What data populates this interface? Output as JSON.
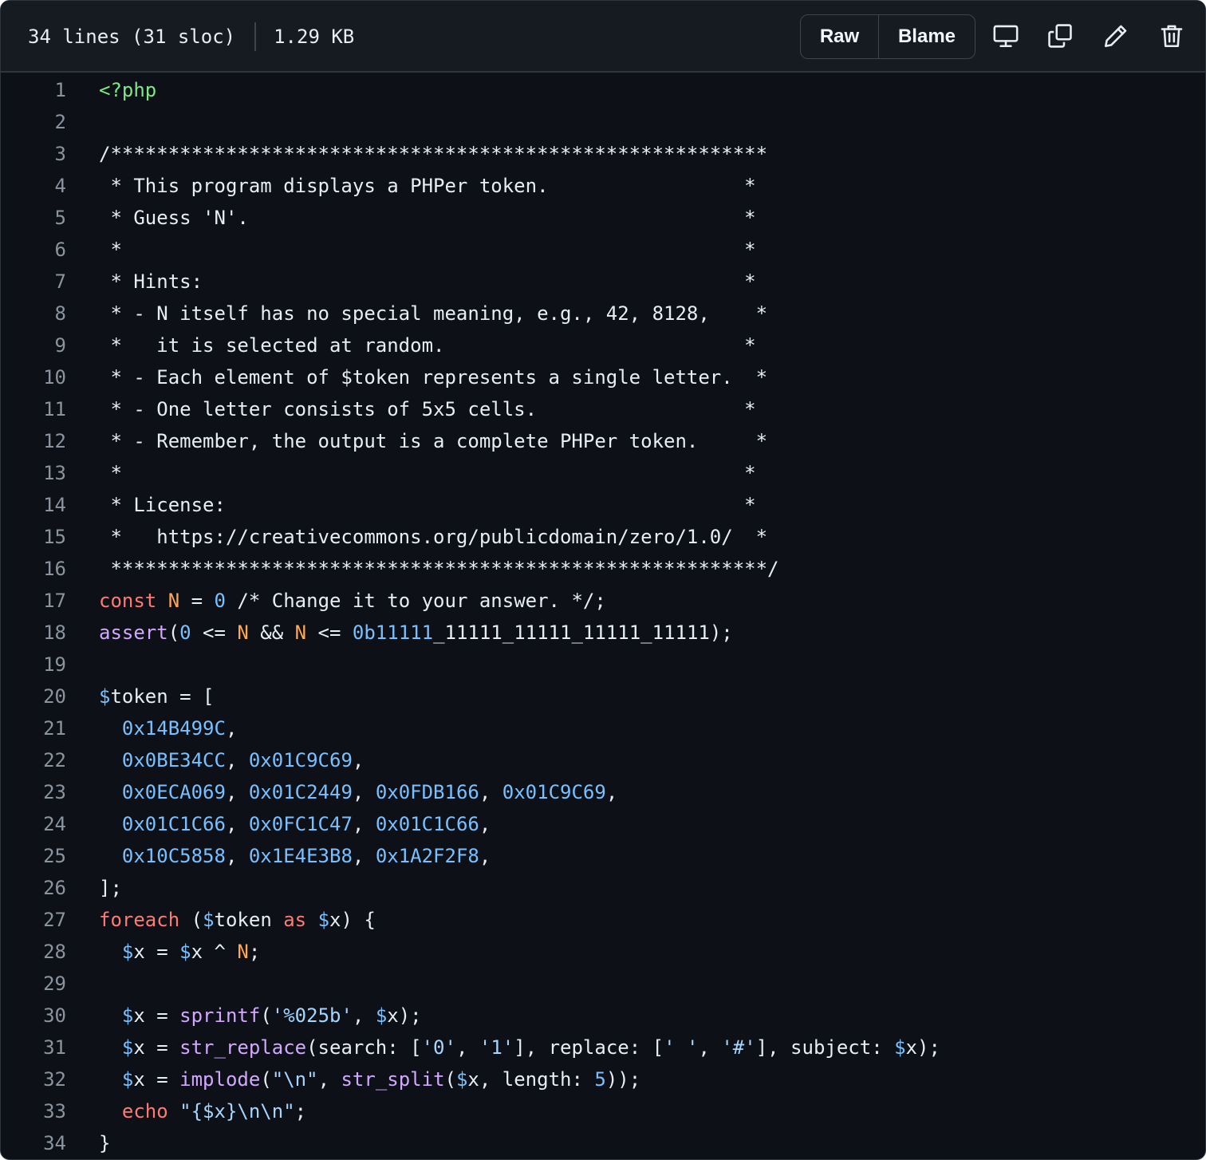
{
  "file_info": {
    "lines_label": "34 lines (31 sloc)",
    "size_label": "1.29 KB"
  },
  "toolbar": {
    "raw_label": "Raw",
    "blame_label": "Blame",
    "icons": [
      "desktop-icon",
      "copy-icon",
      "pencil-icon",
      "trash-icon"
    ]
  },
  "theme": {
    "background": "#0d1117",
    "header_background": "#161b22",
    "border": "#30363d",
    "line_number": "#8b949e",
    "text": "#e6edf3",
    "keyword": "#ff7b72",
    "constant": "#ffa657",
    "number": "#79c0ff",
    "function": "#d2a8ff",
    "string": "#a5d6ff",
    "tag": "#7ee787"
  },
  "code": {
    "lines": [
      {
        "n": "1",
        "tokens": [
          [
            "<?php",
            "tag"
          ]
        ]
      },
      {
        "n": "2",
        "tokens": []
      },
      {
        "n": "3",
        "tokens": [
          [
            "/*********************************************************",
            "comment"
          ]
        ]
      },
      {
        "n": "4",
        "tokens": [
          [
            " * This program displays a PHPer token.                 *",
            "comment"
          ]
        ]
      },
      {
        "n": "5",
        "tokens": [
          [
            " * Guess 'N'.                                           *",
            "comment"
          ]
        ]
      },
      {
        "n": "6",
        "tokens": [
          [
            " *                                                      *",
            "comment"
          ]
        ]
      },
      {
        "n": "7",
        "tokens": [
          [
            " * Hints:                                               *",
            "comment"
          ]
        ]
      },
      {
        "n": "8",
        "tokens": [
          [
            " * - N itself has no special meaning, e.g., 42, 8128,    *",
            "comment"
          ]
        ]
      },
      {
        "n": "9",
        "tokens": [
          [
            " *   it is selected at random.                          *",
            "comment"
          ]
        ]
      },
      {
        "n": "10",
        "tokens": [
          [
            " * - Each element of $token represents a single letter.  *",
            "comment"
          ]
        ]
      },
      {
        "n": "11",
        "tokens": [
          [
            " * - One letter consists of 5x5 cells.                  *",
            "comment"
          ]
        ]
      },
      {
        "n": "12",
        "tokens": [
          [
            " * - Remember, the output is a complete PHPer token.     *",
            "comment"
          ]
        ]
      },
      {
        "n": "13",
        "tokens": [
          [
            " *                                                      *",
            "comment"
          ]
        ]
      },
      {
        "n": "14",
        "tokens": [
          [
            " * License:                                             *",
            "comment"
          ]
        ]
      },
      {
        "n": "15",
        "tokens": [
          [
            " *   https://creativecommons.org/publicdomain/zero/1.0/  *",
            "comment"
          ]
        ]
      },
      {
        "n": "16",
        "tokens": [
          [
            " *********************************************************/",
            "comment"
          ]
        ]
      },
      {
        "n": "17",
        "tokens": [
          [
            "const",
            "keyword"
          ],
          [
            " ",
            "plain"
          ],
          [
            "N",
            "constant"
          ],
          [
            " = ",
            "plain"
          ],
          [
            "0",
            "number"
          ],
          [
            " /* Change it to your answer. */;",
            "comment"
          ]
        ]
      },
      {
        "n": "18",
        "tokens": [
          [
            "assert",
            "function"
          ],
          [
            "(",
            "plain"
          ],
          [
            "0",
            "number"
          ],
          [
            " <= ",
            "plain"
          ],
          [
            "N",
            "constant"
          ],
          [
            " && ",
            "plain"
          ],
          [
            "N",
            "constant"
          ],
          [
            " <= ",
            "plain"
          ],
          [
            "0b11111",
            "number"
          ],
          [
            "_11111_11111_11111_11111);",
            "plain"
          ]
        ]
      },
      {
        "n": "19",
        "tokens": []
      },
      {
        "n": "20",
        "tokens": [
          [
            "$",
            "variable"
          ],
          [
            "token = [",
            "plain"
          ]
        ]
      },
      {
        "n": "21",
        "tokens": [
          [
            "  ",
            "plain"
          ],
          [
            "0x14B499C",
            "number"
          ],
          [
            ",",
            "plain"
          ]
        ]
      },
      {
        "n": "22",
        "tokens": [
          [
            "  ",
            "plain"
          ],
          [
            "0x0BE34CC",
            "number"
          ],
          [
            ", ",
            "plain"
          ],
          [
            "0x01C9C69",
            "number"
          ],
          [
            ",",
            "plain"
          ]
        ]
      },
      {
        "n": "23",
        "tokens": [
          [
            "  ",
            "plain"
          ],
          [
            "0x0ECA069",
            "number"
          ],
          [
            ", ",
            "plain"
          ],
          [
            "0x01C2449",
            "number"
          ],
          [
            ", ",
            "plain"
          ],
          [
            "0x0FDB166",
            "number"
          ],
          [
            ", ",
            "plain"
          ],
          [
            "0x01C9C69",
            "number"
          ],
          [
            ",",
            "plain"
          ]
        ]
      },
      {
        "n": "24",
        "tokens": [
          [
            "  ",
            "plain"
          ],
          [
            "0x01C1C66",
            "number"
          ],
          [
            ", ",
            "plain"
          ],
          [
            "0x0FC1C47",
            "number"
          ],
          [
            ", ",
            "plain"
          ],
          [
            "0x01C1C66",
            "number"
          ],
          [
            ",",
            "plain"
          ]
        ]
      },
      {
        "n": "25",
        "tokens": [
          [
            "  ",
            "plain"
          ],
          [
            "0x10C5858",
            "number"
          ],
          [
            ", ",
            "plain"
          ],
          [
            "0x1E4E3B8",
            "number"
          ],
          [
            ", ",
            "plain"
          ],
          [
            "0x1A2F2F8",
            "number"
          ],
          [
            ",",
            "plain"
          ]
        ]
      },
      {
        "n": "26",
        "tokens": [
          [
            "];",
            "plain"
          ]
        ]
      },
      {
        "n": "27",
        "tokens": [
          [
            "foreach",
            "keyword"
          ],
          [
            " (",
            "plain"
          ],
          [
            "$",
            "variable"
          ],
          [
            "token ",
            "plain"
          ],
          [
            "as",
            "keyword"
          ],
          [
            " ",
            "plain"
          ],
          [
            "$",
            "variable"
          ],
          [
            "x) {",
            "plain"
          ]
        ]
      },
      {
        "n": "28",
        "tokens": [
          [
            "  ",
            "plain"
          ],
          [
            "$",
            "variable"
          ],
          [
            "x = ",
            "plain"
          ],
          [
            "$",
            "variable"
          ],
          [
            "x ^ ",
            "plain"
          ],
          [
            "N",
            "constant"
          ],
          [
            ";",
            "plain"
          ]
        ]
      },
      {
        "n": "29",
        "tokens": []
      },
      {
        "n": "30",
        "tokens": [
          [
            "  ",
            "plain"
          ],
          [
            "$",
            "variable"
          ],
          [
            "x = ",
            "plain"
          ],
          [
            "sprintf",
            "function"
          ],
          [
            "(",
            "plain"
          ],
          [
            "'%025b'",
            "string"
          ],
          [
            ", ",
            "plain"
          ],
          [
            "$",
            "variable"
          ],
          [
            "x);",
            "plain"
          ]
        ]
      },
      {
        "n": "31",
        "tokens": [
          [
            "  ",
            "plain"
          ],
          [
            "$",
            "variable"
          ],
          [
            "x = ",
            "plain"
          ],
          [
            "str_replace",
            "function"
          ],
          [
            "(search: [",
            "plain"
          ],
          [
            "'0'",
            "string"
          ],
          [
            ", ",
            "plain"
          ],
          [
            "'1'",
            "string"
          ],
          [
            "], replace: [",
            "plain"
          ],
          [
            "' '",
            "string"
          ],
          [
            ", ",
            "plain"
          ],
          [
            "'#'",
            "string"
          ],
          [
            "], subject: ",
            "plain"
          ],
          [
            "$",
            "variable"
          ],
          [
            "x);",
            "plain"
          ]
        ]
      },
      {
        "n": "32",
        "tokens": [
          [
            "  ",
            "plain"
          ],
          [
            "$",
            "variable"
          ],
          [
            "x = ",
            "plain"
          ],
          [
            "implode",
            "function"
          ],
          [
            "(",
            "plain"
          ],
          [
            "\"\\n\"",
            "string"
          ],
          [
            ", ",
            "plain"
          ],
          [
            "str_split",
            "function"
          ],
          [
            "(",
            "plain"
          ],
          [
            "$",
            "variable"
          ],
          [
            "x, length: ",
            "plain"
          ],
          [
            "5",
            "number"
          ],
          [
            "));",
            "plain"
          ]
        ]
      },
      {
        "n": "33",
        "tokens": [
          [
            "  ",
            "plain"
          ],
          [
            "echo",
            "keyword"
          ],
          [
            " ",
            "plain"
          ],
          [
            "\"{$x}\\n\\n\"",
            "string"
          ],
          [
            ";",
            "plain"
          ]
        ]
      },
      {
        "n": "34",
        "tokens": [
          [
            "}",
            "plain"
          ]
        ]
      }
    ]
  }
}
